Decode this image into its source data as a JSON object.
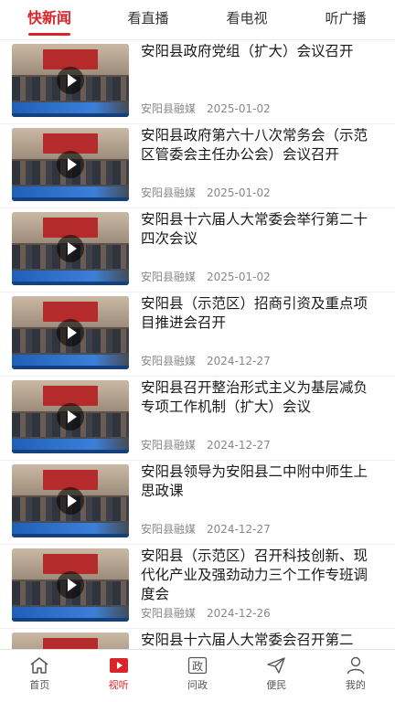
{
  "tabs": [
    {
      "label": "快新闻",
      "active": true
    },
    {
      "label": "看直播",
      "active": false
    },
    {
      "label": "看电视",
      "active": false
    },
    {
      "label": "听广播",
      "active": false
    }
  ],
  "articles": [
    {
      "title": "安阳县政府党组（扩大）会议召开",
      "source": "安阳县融媒",
      "date": "2025-01-02"
    },
    {
      "title": "安阳县政府第六十八次常务会（示范区管委会主任办公会）会议召开",
      "source": "安阳县融媒",
      "date": "2025-01-02"
    },
    {
      "title": "安阳县十六届人大常委会举行第二十四次会议",
      "source": "安阳县融媒",
      "date": "2025-01-02"
    },
    {
      "title": "安阳县（示范区）招商引资及重点项目推进会召开",
      "source": "安阳县融媒",
      "date": "2024-12-27"
    },
    {
      "title": "安阳县召开整治形式主义为基层减负专项工作机制（扩大）会议",
      "source": "安阳县融媒",
      "date": "2024-12-27"
    },
    {
      "title": "安阳县领导为安阳县二中附中师生上思政课",
      "source": "安阳县融媒",
      "date": "2024-12-27"
    },
    {
      "title": "安阳县（示范区）召开科技创新、现代化产业及强劲动力三个工作专班调度会",
      "source": "安阳县融媒",
      "date": "2024-12-26"
    },
    {
      "title": "安阳县十六届人大常委会召开第二",
      "source": "",
      "date": ""
    }
  ],
  "bottom_nav": [
    {
      "label": "首页",
      "icon": "home-icon",
      "active": false
    },
    {
      "label": "视听",
      "icon": "video-icon",
      "active": true
    },
    {
      "label": "问政",
      "icon": "inquiry-icon",
      "active": false
    },
    {
      "label": "便民",
      "icon": "send-icon",
      "active": false
    },
    {
      "label": "我的",
      "icon": "user-icon",
      "active": false
    }
  ],
  "colors": {
    "accent": "#d9252a"
  }
}
